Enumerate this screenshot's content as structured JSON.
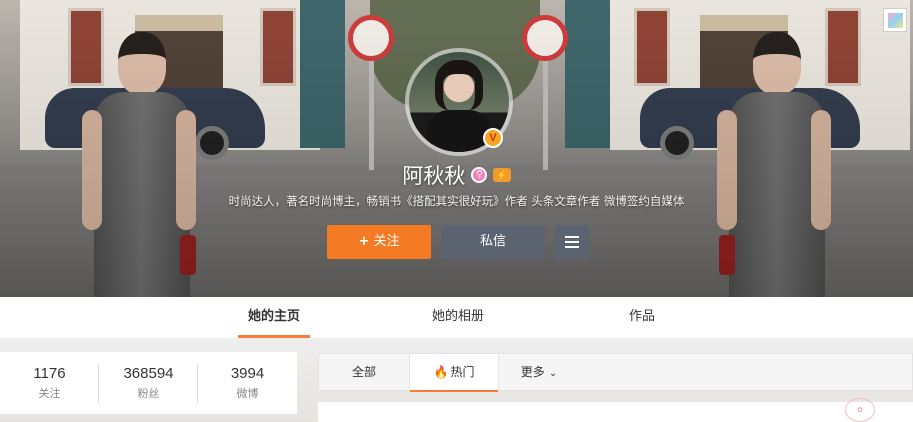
{
  "profile": {
    "name": "阿秋秋",
    "level_badge": "⚡",
    "verified_badge": "V",
    "gender_icon": "♀",
    "bio": "时尚达人，著名时尚博主，畅销书《搭配其实很好玩》作者 头条文章作者 微博签约自媒体"
  },
  "actions": {
    "follow_label": "关注",
    "follow_icon": "+",
    "message_label": "私信"
  },
  "tabs": [
    {
      "label": "她的主页",
      "active": true
    },
    {
      "label": "她的相册",
      "active": false
    },
    {
      "label": "作品",
      "active": false
    }
  ],
  "stats": [
    {
      "value": "1176",
      "label": "关注"
    },
    {
      "value": "368594",
      "label": "粉丝"
    },
    {
      "value": "3994",
      "label": "微博"
    }
  ],
  "feed_filters": {
    "all": "全部",
    "hot": "热门",
    "more": "更多"
  },
  "colors": {
    "accent": "#fa7d3c",
    "follow_button": "#f47a24",
    "secondary_button": "#5c6370"
  }
}
